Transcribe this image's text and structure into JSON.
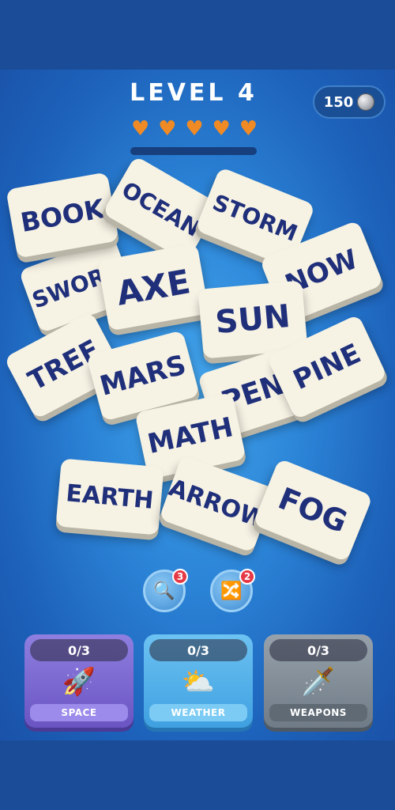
{
  "header": {
    "level_title": "LEVEL 4",
    "coins": "150",
    "coin_icon": "silver-coin-icon",
    "lives": 5,
    "heart_glyph": "♥",
    "level_progress": 0
  },
  "tiles": [
    "SWORD",
    "BOOK",
    "OCEAN",
    "STORM",
    "NOW",
    "AXE",
    "SUN",
    "TREE",
    "PEN",
    "MARS",
    "PINE",
    "MATH",
    "EARTH",
    "ARROW",
    "FOG"
  ],
  "tools": {
    "search": {
      "icon": "magnifier-icon",
      "glyph": "🔍",
      "count": "3"
    },
    "shuffle": {
      "icon": "shuffle-icon",
      "glyph": "🔀",
      "count": "2"
    }
  },
  "categories": [
    {
      "count": "0/3",
      "label": "SPACE",
      "icon": "rocket-icon",
      "glyph": "🚀"
    },
    {
      "count": "0/3",
      "label": "WEATHER",
      "icon": "sun-cloud-icon",
      "glyph": "⛅"
    },
    {
      "count": "0/3",
      "label": "WEAPONS",
      "icon": "dagger-icon",
      "glyph": "🗡️"
    }
  ],
  "colors": {
    "tile_text": "#1f2f7a",
    "tile_face": "#f6f2e4",
    "heart": "#f08a24",
    "space_card": "#7059c9",
    "weather_card": "#49aeea",
    "weapons_card": "#7d8a96"
  }
}
